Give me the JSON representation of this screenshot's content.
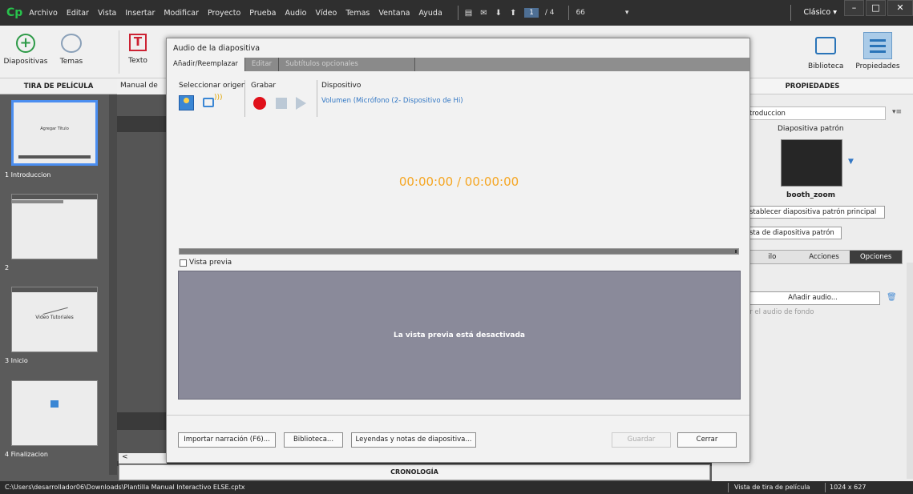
{
  "app": {
    "logo": "Cp",
    "menu": [
      "Archivo",
      "Editar",
      "Vista",
      "Insertar",
      "Modificar",
      "Proyecto",
      "Prueba",
      "Audio",
      "Vídeo",
      "Temas",
      "Ventana",
      "Ayuda"
    ],
    "current_page": "1",
    "total_pages": "/ 4",
    "zoom": "66",
    "workspace": "Clásico",
    "workspace_caret": "▾"
  },
  "toolbar": {
    "slides_label": "Diapositivas",
    "themes_label": "Temas",
    "text_label": "Texto",
    "library_label": "Biblioteca",
    "properties_label": "Propiedades"
  },
  "filmstrip": {
    "header": "TIRA DE PELÍCULA",
    "slides": [
      {
        "label": "1 Introduccion",
        "title": "Agregar Título"
      },
      {
        "label": "2"
      },
      {
        "label": "3 Inicio",
        "title": "Video Tutoriales"
      },
      {
        "label": "4 Finalizacion"
      }
    ]
  },
  "stage": {
    "tab_label": "Manual de",
    "scroll_left": "<"
  },
  "timeline": {
    "label": "CRONOLOGÍA"
  },
  "properties": {
    "header": "PROPIEDADES",
    "slide_name": "troduccion",
    "master_label": "Diapositiva patrón",
    "master_name": "booth_zoom",
    "reset_btn": "stablecer diapositiva patrón principal",
    "master_view_btn": "sta de diapositiva patrón",
    "tabs": [
      "ilo",
      "Acciones",
      "Opciones"
    ],
    "add_audio_btn": "Añadir audio...",
    "bg_audio_hint": "er el audio de fondo"
  },
  "status": {
    "path": "C:\\Users\\desarrollador06\\Downloads\\Plantilla Manual Interactivo ELSE.cptx",
    "view": "Vista de tira de película",
    "dims": "1024 x 627"
  },
  "dialog": {
    "title": "Audio de la diapositiva",
    "tabs": [
      "Añadir/Reemplazar",
      "Editar",
      "Subtítulos opcionales"
    ],
    "select_source_label": "Seleccionar origen",
    "record_label": "Grabar",
    "device_label": "Dispositivo",
    "device_value": "Volumen (Micrófono (2- Dispositivo de Hi)",
    "timecode": "00:00:00 / 00:00:00",
    "preview_checkbox": "Vista previa",
    "preview_disabled": "La vista previa está desactivada",
    "buttons": {
      "import": "Importar narración (F6)...",
      "library": "Biblioteca...",
      "captions": "Leyendas y notas de diapositiva...",
      "save": "Guardar",
      "close": "Cerrar"
    }
  },
  "colors": {
    "accent": "#3277c4",
    "timecode": "#f5a623",
    "record": "#e0101a",
    "logo": "#28c34c"
  }
}
